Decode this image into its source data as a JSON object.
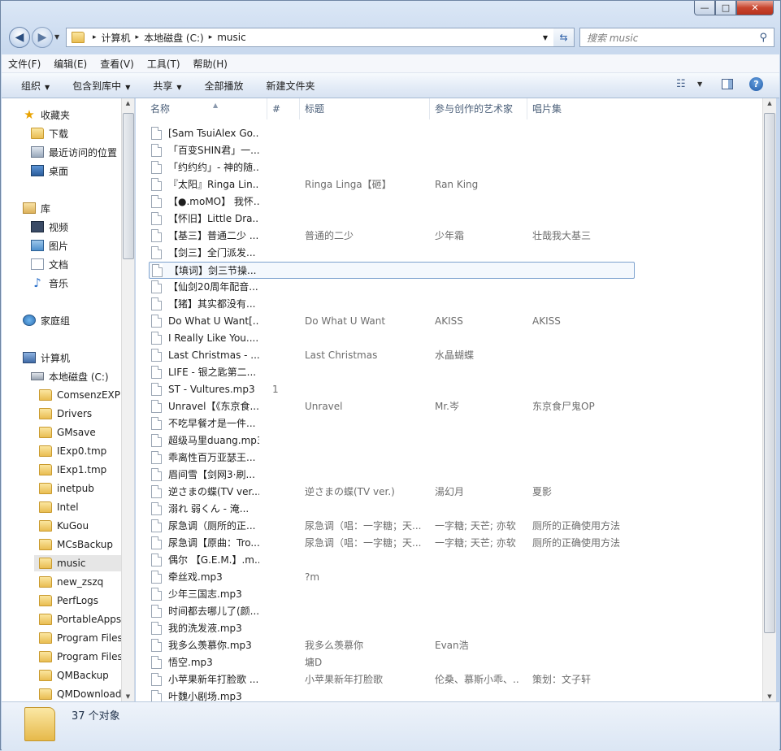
{
  "window": {
    "minimize_glyph": "—",
    "maximize_glyph": "□",
    "close_glyph": "✕"
  },
  "address": {
    "crumbs": [
      "计算机",
      "本地磁盘 (C:)",
      "music"
    ],
    "separator": "▸",
    "search_placeholder": "搜索 music"
  },
  "menu": [
    "文件(F)",
    "编辑(E)",
    "查看(V)",
    "工具(T)",
    "帮助(H)"
  ],
  "toolbar": {
    "organize": "组织",
    "include_in_library": "包含到库中",
    "share": "共享",
    "play_all": "全部播放",
    "new_folder": "新建文件夹"
  },
  "nav": {
    "favorites": "收藏夹",
    "downloads": "下载",
    "recent": "最近访问的位置",
    "desktop": "桌面",
    "libraries": "库",
    "videos": "视频",
    "pictures": "图片",
    "documents": "文档",
    "music": "音乐",
    "homegroup": "家庭组",
    "computer": "计算机",
    "local_disk": "本地磁盘 (C:)",
    "folders": [
      "ComsenzEXP",
      "Drivers",
      "GMsave",
      "IExp0.tmp",
      "IExp1.tmp",
      "inetpub",
      "Intel",
      "KuGou",
      "MCsBackup",
      "music",
      "new_zszq",
      "PerfLogs",
      "PortableApps",
      "Program Files",
      "Program Files",
      "QMBackup",
      "QMDownload"
    ],
    "selected_folder": "music"
  },
  "columns": {
    "name": "名称",
    "number": "#",
    "title": "标题",
    "artist": "参与创作的艺术家",
    "album": "唱片集"
  },
  "files": [
    {
      "name": "[Sam TsuiAlex Go...",
      "num": "",
      "title": "",
      "artist": "",
      "album": ""
    },
    {
      "name": "「百变SHIN君」一...",
      "num": "",
      "title": "",
      "artist": "",
      "album": ""
    },
    {
      "name": "「约约约」- 神的随...",
      "num": "",
      "title": "",
      "artist": "",
      "album": ""
    },
    {
      "name": "『太阳』Ringa Lin...",
      "num": "",
      "title": "Ringa Linga【砸】",
      "artist": "Ran King",
      "album": ""
    },
    {
      "name": "【●.moMO】 我怀...",
      "num": "",
      "title": "",
      "artist": "",
      "album": ""
    },
    {
      "name": "【怀旧】Little Dra...",
      "num": "",
      "title": "",
      "artist": "",
      "album": ""
    },
    {
      "name": "【基三】普通二少 ...",
      "num": "",
      "title": "普通的二少",
      "artist": "少年霜",
      "album": "壮哉我大基三"
    },
    {
      "name": "【剑三】全门派发...",
      "num": "",
      "title": "",
      "artist": "",
      "album": ""
    },
    {
      "name": "【填词】剑三节操...",
      "num": "",
      "title": "",
      "artist": "",
      "album": "",
      "selected": true
    },
    {
      "name": "【仙剑20周年配音...",
      "num": "",
      "title": "",
      "artist": "",
      "album": ""
    },
    {
      "name": "【猪】其实都没有...",
      "num": "",
      "title": "",
      "artist": "",
      "album": ""
    },
    {
      "name": "Do What U Want[...",
      "num": "",
      "title": "Do What U Want",
      "artist": "AKISS",
      "album": "AKISS"
    },
    {
      "name": "I Really Like You....",
      "num": "",
      "title": "",
      "artist": "",
      "album": ""
    },
    {
      "name": "Last Christmas - ...",
      "num": "",
      "title": "Last Christmas",
      "artist": "水晶蝴蝶",
      "album": ""
    },
    {
      "name": "LIFE - 银之匙第二...",
      "num": "",
      "title": "",
      "artist": "",
      "album": ""
    },
    {
      "name": "ST - Vultures.mp3",
      "num": "1",
      "title": "",
      "artist": "",
      "album": ""
    },
    {
      "name": "Unravel【《东京食...",
      "num": "",
      "title": "Unravel",
      "artist": "Mr.岑",
      "album": "东京食尸鬼OP"
    },
    {
      "name": "不吃早餐才是一件...",
      "num": "",
      "title": "",
      "artist": "",
      "album": ""
    },
    {
      "name": "超级马里duang.mp3",
      "num": "",
      "title": "",
      "artist": "",
      "album": ""
    },
    {
      "name": "乖离性百万亚瑟王...",
      "num": "",
      "title": "",
      "artist": "",
      "album": ""
    },
    {
      "name": "眉间雪【剑网3·刷...",
      "num": "",
      "title": "",
      "artist": "",
      "album": ""
    },
    {
      "name": "逆さまの蝶(TV ver....",
      "num": "",
      "title": "逆さまの蝶(TV ver.)",
      "artist": "湯幻月",
      "album": "夏影"
    },
    {
      "name": "溺れ 弱くん - 淹...",
      "num": "",
      "title": "",
      "artist": "",
      "album": ""
    },
    {
      "name": "尿急调（厕所的正...",
      "num": "",
      "title": "尿急调（唱：一字糖；天...",
      "artist": "一字糖; 天芒; 亦软",
      "album": "厕所的正确使用方法"
    },
    {
      "name": "尿急调【原曲：Tro...",
      "num": "",
      "title": "尿急调（唱：一字糖；天...",
      "artist": "一字糖; 天芒; 亦软",
      "album": "厕所的正确使用方法"
    },
    {
      "name": "偶尔 【G.E.M.】.m...",
      "num": "",
      "title": "",
      "artist": "",
      "album": ""
    },
    {
      "name": "牵丝戏.mp3",
      "num": "",
      "title": "?m",
      "artist": "",
      "album": ""
    },
    {
      "name": "少年三国志.mp3",
      "num": "",
      "title": "",
      "artist": "",
      "album": ""
    },
    {
      "name": "时间都去哪儿了(颜...",
      "num": "",
      "title": "",
      "artist": "",
      "album": ""
    },
    {
      "name": "我的洗发液.mp3",
      "num": "",
      "title": "",
      "artist": "",
      "album": ""
    },
    {
      "name": "我多么羡慕你.mp3",
      "num": "",
      "title": "我多么羡慕你",
      "artist": "Evan浩",
      "album": ""
    },
    {
      "name": "悟空.mp3",
      "num": "",
      "title": "墉D",
      "artist": "",
      "album": ""
    },
    {
      "name": "小苹果新年打脸歌 ...",
      "num": "",
      "title": "小苹果新年打脸歌",
      "artist": "伦桑、慕斯小乖、...",
      "album": "策划：文子轩"
    },
    {
      "name": "叶魏小剧场.mp3",
      "num": "",
      "title": "",
      "artist": "",
      "album": ""
    }
  ],
  "status": {
    "count_text": "37 个对象"
  }
}
